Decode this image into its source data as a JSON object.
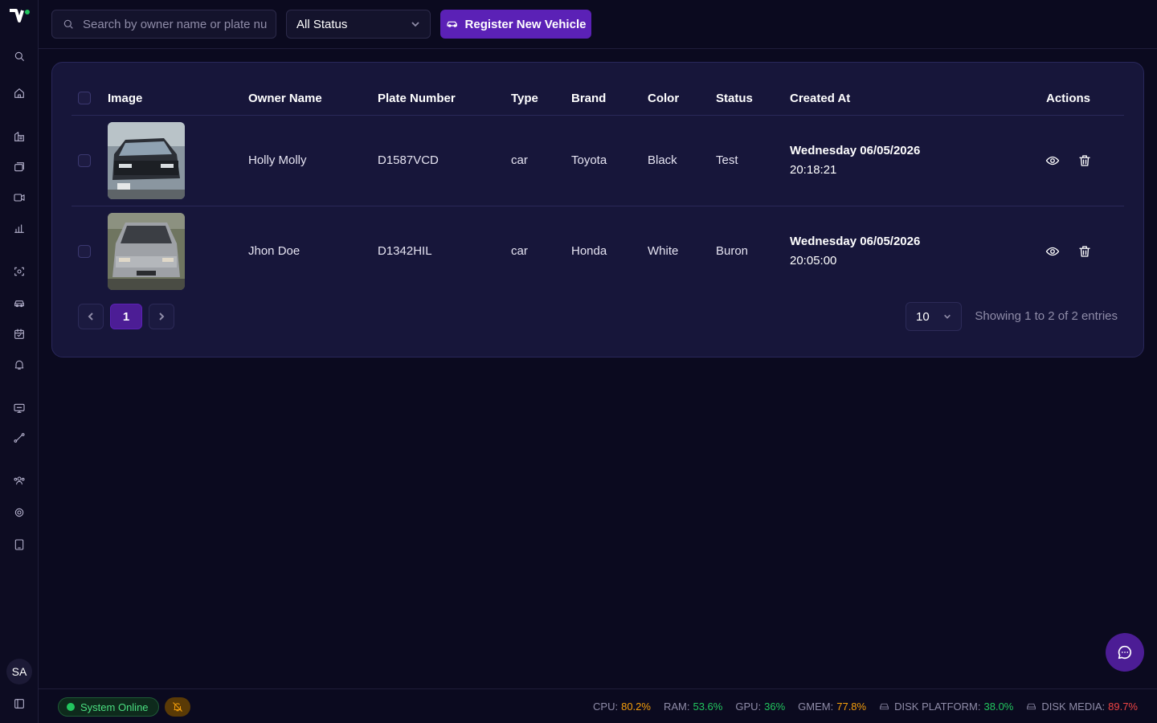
{
  "sidebar": {
    "avatar_initials": "SA",
    "icons": [
      "search-icon",
      "home-icon",
      "building-icon",
      "layers-icon",
      "video-camera-icon",
      "bar-chart-icon",
      "face-scan-icon",
      "car-icon",
      "calendar-icon",
      "bell-icon",
      "monitor-icon",
      "route-icon",
      "users-icon",
      "settings-icon",
      "tablet-icon"
    ]
  },
  "toolbar": {
    "search_placeholder": "Search by owner name or plate number",
    "status_filter": "All Status",
    "register_label": "Register New Vehicle"
  },
  "table": {
    "columns": [
      "Image",
      "Owner Name",
      "Plate Number",
      "Type",
      "Brand",
      "Color",
      "Status",
      "Created At",
      "Actions"
    ],
    "rows": [
      {
        "owner": "Holly Molly",
        "plate": "D1587VCD",
        "type": "car",
        "brand": "Toyota",
        "color": "Black",
        "status": "Test",
        "created_date": "Wednesday 06/05/2026",
        "created_time": "20:18:21"
      },
      {
        "owner": "Jhon Doe",
        "plate": "D1342HIL",
        "type": "car",
        "brand": "Honda",
        "color": "White",
        "status": "Buron",
        "created_date": "Wednesday 06/05/2026",
        "created_time": "20:05:00"
      }
    ]
  },
  "pagination": {
    "current_page": "1",
    "per_page": "10",
    "showing_text": "Showing 1 to 2 of 2 entries"
  },
  "statusbar": {
    "online_label": "System Online",
    "metrics": [
      {
        "label": "CPU:",
        "value": "80.2%",
        "color": "#f59e0b"
      },
      {
        "label": "RAM:",
        "value": "53.6%",
        "color": "#22c55e"
      },
      {
        "label": "GPU:",
        "value": "36%",
        "color": "#22c55e"
      },
      {
        "label": "GMEM:",
        "value": "77.8%",
        "color": "#f59e0b"
      },
      {
        "label": "DISK PLATFORM:",
        "value": "38.0%",
        "color": "#22c55e"
      },
      {
        "label": "DISK MEDIA:",
        "value": "89.7%",
        "color": "#ef4444"
      }
    ]
  },
  "colors": {
    "accent": "#5b21b6",
    "background": "#0b0a1f",
    "card": "#17163a"
  }
}
